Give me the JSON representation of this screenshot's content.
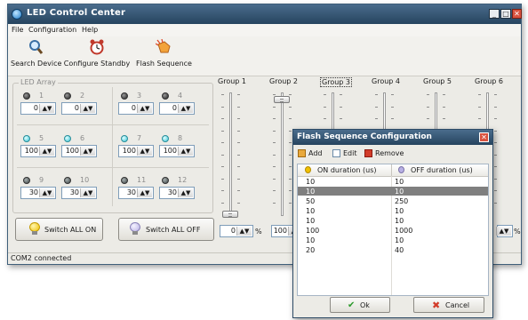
{
  "window": {
    "title": "LED Control Center"
  },
  "menu": [
    {
      "label": "File"
    },
    {
      "label": "Configuration"
    },
    {
      "label": "Help"
    }
  ],
  "toolbar": [
    {
      "label": "Search Device",
      "icon": "magnifier-icon"
    },
    {
      "label": "Configure Standby",
      "icon": "alarm-clock-icon"
    },
    {
      "label": "Flash Sequence",
      "icon": "hand-flash-icon"
    }
  ],
  "led_array": {
    "legend": "LED Array",
    "leds": [
      {
        "num": "1",
        "value": "0",
        "state": "off"
      },
      {
        "num": "2",
        "value": "0",
        "state": "off"
      },
      {
        "num": "3",
        "value": "0",
        "state": "off"
      },
      {
        "num": "4",
        "value": "0",
        "state": "off"
      },
      {
        "num": "5",
        "value": "100",
        "state": "on"
      },
      {
        "num": "6",
        "value": "100",
        "state": "on"
      },
      {
        "num": "7",
        "value": "100",
        "state": "on"
      },
      {
        "num": "8",
        "value": "100",
        "state": "on"
      },
      {
        "num": "9",
        "value": "30",
        "state": "dim"
      },
      {
        "num": "10",
        "value": "30",
        "state": "dim"
      },
      {
        "num": "11",
        "value": "30",
        "state": "dim"
      },
      {
        "num": "12",
        "value": "30",
        "state": "dim"
      }
    ]
  },
  "buttons": {
    "switch_on": "Switch ALL ON",
    "switch_off": "Switch ALL OFF"
  },
  "groups": [
    {
      "label": "Group 1",
      "value": "0",
      "level": 0
    },
    {
      "label": "Group 2",
      "value": "100",
      "level": 1
    },
    {
      "label": "Group 3"
    },
    {
      "label": "Group 4"
    },
    {
      "label": "Group 5"
    },
    {
      "label": "Group 6"
    }
  ],
  "percent_sign": "%",
  "status": "COM2 connected",
  "dialog": {
    "title": "Flash Sequence Configuration",
    "add": "Add",
    "edit": "Edit",
    "remove": "Remove",
    "col_on": "ON duration (us)",
    "col_off": "OFF duration (us)",
    "rows": [
      {
        "on": "10",
        "off": "10"
      },
      {
        "on": "10",
        "off": "10",
        "selected": true
      },
      {
        "on": "50",
        "off": "250"
      },
      {
        "on": "10",
        "off": "10"
      },
      {
        "on": "10",
        "off": "10"
      },
      {
        "on": "100",
        "off": "1000"
      },
      {
        "on": "10",
        "off": "10"
      },
      {
        "on": "20",
        "off": "40"
      }
    ],
    "ok": "Ok",
    "cancel": "Cancel"
  }
}
